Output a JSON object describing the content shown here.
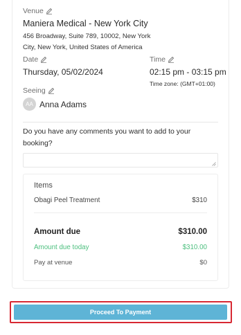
{
  "venue": {
    "label": "Venue",
    "name": "Maniera Medical - New York City",
    "address": "456 Broadway, Suite 789, 10002, New York City, New York, United States of America"
  },
  "date": {
    "label": "Date",
    "value": "Thursday, 05/02/2024"
  },
  "time": {
    "label": "Time",
    "value": "02:15 pm - 03:15 pm",
    "timezone": "Time zone: (GMT+01:00)"
  },
  "seeing": {
    "label": "Seeing",
    "initials": "AA",
    "name": "Anna Adams"
  },
  "comments": {
    "question": "Do you have any comments you want to add to your booking?",
    "value": ""
  },
  "summary": {
    "items_header": "Items",
    "item_name": "Obagi Peel Treatment",
    "item_price": "$310",
    "amount_due_label": "Amount due",
    "amount_due_value": "$310.00",
    "due_today_label": "Amount due today",
    "due_today_value": "$310.00",
    "pay_at_venue_label": "Pay at venue",
    "pay_at_venue_value": "$0"
  },
  "actions": {
    "proceed_label": "Proceed To Payment"
  },
  "colors": {
    "accent_green": "#4cbf7e",
    "button_blue": "#5eb4d6",
    "highlight_red": "#d72832"
  },
  "icons": [
    "pencil-icon",
    "resize-grip-icon"
  ]
}
